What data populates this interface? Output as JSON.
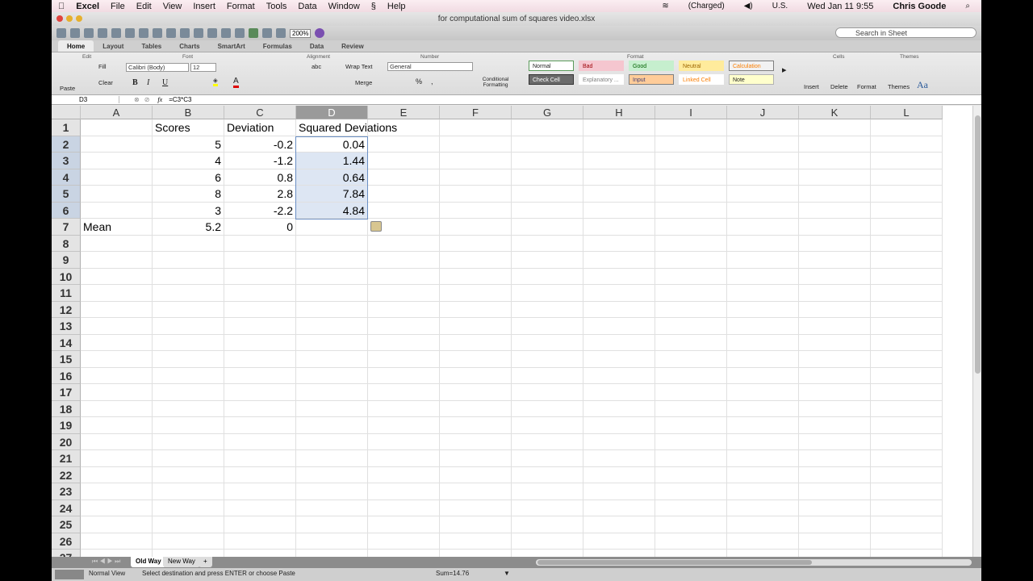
{
  "menubar": {
    "app": "Excel",
    "items": [
      "File",
      "Edit",
      "View",
      "Insert",
      "Format",
      "Tools",
      "Data",
      "Window",
      "Help"
    ],
    "battery": "(Charged)",
    "locale": "U.S.",
    "datetime": "Wed Jan 11  9:55",
    "user": "Chris Goode"
  },
  "window": {
    "title": "for computational sum of squares video.xlsx"
  },
  "toolbar": {
    "zoom": "200%",
    "search_placeholder": "Search in Sheet"
  },
  "ribbon_tabs": [
    "Home",
    "Layout",
    "Tables",
    "Charts",
    "SmartArt",
    "Formulas",
    "Data",
    "Review"
  ],
  "ribbon": {
    "groups": {
      "edit": "Edit",
      "font": "Font",
      "alignment": "Alignment",
      "number": "Number",
      "format": "Format",
      "cells": "Cells",
      "themes": "Themes"
    },
    "paste": "Paste",
    "fill": "Fill",
    "clear": "Clear",
    "font_name": "Calibri (Body)",
    "font_size": "12",
    "bold": "B",
    "italic": "I",
    "underline": "U",
    "wrap_text": "Wrap Text",
    "merge": "Merge",
    "abc": "abc",
    "number_format": "General",
    "percent": "%",
    "comma": ",",
    "conditional_formatting": "Conditional Formatting",
    "styles": [
      {
        "label": "Normal",
        "bg": "#ffffff",
        "fg": "#222",
        "border": "#5a9a5a"
      },
      {
        "label": "Bad",
        "bg": "#f5c6cf",
        "fg": "#9c0006",
        "border": "#f5c6cf"
      },
      {
        "label": "Good",
        "bg": "#c6efce",
        "fg": "#006100",
        "border": "#c6efce"
      },
      {
        "label": "Neutral",
        "bg": "#ffeb9c",
        "fg": "#9c6500",
        "border": "#ffeb9c"
      },
      {
        "label": "Calculation",
        "bg": "#f2f2f2",
        "fg": "#fa7d00",
        "border": "#7f7f7f"
      },
      {
        "label": "Check Cell",
        "bg": "#6b6b6b",
        "fg": "#ffffff",
        "border": "#333"
      },
      {
        "label": "Explanatory ...",
        "bg": "#ffffff",
        "fg": "#7f7f7f",
        "border": "#fff"
      },
      {
        "label": "Input",
        "bg": "#ffcc99",
        "fg": "#3f3f76",
        "border": "#7f7f7f"
      },
      {
        "label": "Linked Cell",
        "bg": "#ffffff",
        "fg": "#fa7d00",
        "border": "#fff"
      },
      {
        "label": "Note",
        "bg": "#ffffcc",
        "fg": "#222",
        "border": "#b2b2b2"
      }
    ],
    "insert": "Insert",
    "delete": "Delete",
    "format": "Format",
    "themes": "Themes",
    "aa": "Aa"
  },
  "formula_bar": {
    "name_box": "D3",
    "fx": "fx",
    "formula": "=C3*C3"
  },
  "columns": [
    "A",
    "B",
    "C",
    "D",
    "E",
    "F",
    "G",
    "H",
    "I",
    "J",
    "K",
    "L"
  ],
  "selected_column": "D",
  "rows": [
    [
      "",
      "Scores",
      "Deviation",
      "Squared Deviations"
    ],
    [
      "",
      "5",
      "-0.2",
      "0.04"
    ],
    [
      "",
      "4",
      "-1.2",
      "1.44"
    ],
    [
      "",
      "6",
      "0.8",
      "0.64"
    ],
    [
      "",
      "8",
      "2.8",
      "7.84"
    ],
    [
      "",
      "3",
      "-2.2",
      "4.84"
    ],
    [
      "Mean",
      "5.2",
      "0",
      ""
    ]
  ],
  "row_count": 27,
  "sheets": [
    "Old Way",
    "New Way"
  ],
  "status": {
    "view": "Normal View",
    "message": "Select destination and press ENTER or choose Paste",
    "sum": "Sum=14.76"
  }
}
